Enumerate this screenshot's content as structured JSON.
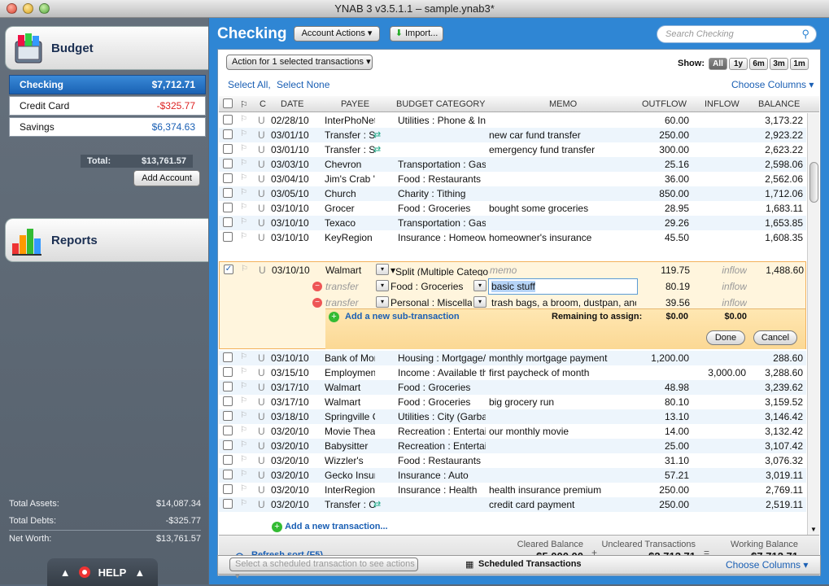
{
  "window": {
    "title": "YNAB 3 v3.5.1.1 – sample.ynab3*"
  },
  "sidebar": {
    "budget_label": "Budget",
    "reports_label": "Reports",
    "accounts": [
      {
        "name": "Checking",
        "amount": "$7,712.71"
      },
      {
        "name": "Credit Card",
        "amount": "-$325.77"
      },
      {
        "name": "Savings",
        "amount": "$6,374.63"
      }
    ],
    "total_label": "Total:",
    "total_value": "$13,761.57",
    "add_account": "Add Account",
    "total_assets_label": "Total Assets:",
    "total_assets": "$14,087.34",
    "total_debts_label": "Total Debts:",
    "total_debts": "-$325.77",
    "net_worth_label": "Net Worth:",
    "net_worth": "$13,761.57",
    "help": "HELP"
  },
  "header": {
    "title": "Checking",
    "account_actions": "Account Actions",
    "import": "Import...",
    "search_placeholder": "Search Checking"
  },
  "toolbar": {
    "action": "Action for 1 selected transactions",
    "show": "Show:",
    "show_options": [
      "All",
      "1y",
      "6m",
      "3m",
      "1m"
    ],
    "select_all": "Select All,",
    "select_none": "Select None",
    "choose_columns": "Choose Columns"
  },
  "columns": {
    "c": "C",
    "date": "DATE",
    "payee": "PAYEE",
    "category": "BUDGET CATEGORY",
    "memo": "MEMO",
    "outflow": "OUTFLOW",
    "inflow": "INFLOW",
    "balance": "BALANCE"
  },
  "rows_top": [
    {
      "c": "U",
      "date": "02/28/10",
      "payee": "InterPhoNet",
      "category": "Utilities : Phone & Inte",
      "memo": "",
      "outflow": "60.00",
      "inflow": "",
      "balance": "3,173.22"
    },
    {
      "c": "U",
      "date": "03/01/10",
      "payee": "Transfer : Sa",
      "category": "",
      "memo": "new car fund transfer",
      "outflow": "250.00",
      "inflow": "",
      "balance": "2,923.22"
    },
    {
      "c": "U",
      "date": "03/01/10",
      "payee": "Transfer : Sa",
      "category": "",
      "memo": "emergency fund transfer",
      "outflow": "300.00",
      "inflow": "",
      "balance": "2,623.22"
    },
    {
      "c": "U",
      "date": "03/03/10",
      "payee": "Chevron",
      "category": "Transportation : Gas",
      "memo": "",
      "outflow": "25.16",
      "inflow": "",
      "balance": "2,598.06"
    },
    {
      "c": "U",
      "date": "03/04/10",
      "payee": "Jim's Crab 'n Gr",
      "category": "Food : Restaurants",
      "memo": "",
      "outflow": "36.00",
      "inflow": "",
      "balance": "2,562.06"
    },
    {
      "c": "U",
      "date": "03/05/10",
      "payee": "Church",
      "category": "Charity : Tithing",
      "memo": "",
      "outflow": "850.00",
      "inflow": "",
      "balance": "1,712.06"
    },
    {
      "c": "U",
      "date": "03/10/10",
      "payee": "Grocer",
      "category": "Food : Groceries",
      "memo": "bought some groceries",
      "outflow": "28.95",
      "inflow": "",
      "balance": "1,683.11"
    },
    {
      "c": "U",
      "date": "03/10/10",
      "payee": "Texaco",
      "category": "Transportation : Gas",
      "memo": "",
      "outflow": "29.26",
      "inflow": "",
      "balance": "1,653.85"
    },
    {
      "c": "U",
      "date": "03/10/10",
      "payee": "KeyRegion Insu",
      "category": "Insurance : Homeow",
      "memo": "homeowner's insurance",
      "outflow": "45.50",
      "inflow": "",
      "balance": "1,608.35"
    }
  ],
  "split": {
    "c": "U",
    "date": "03/10/10",
    "payee": "Walmart",
    "category": "Split (Multiple Catego",
    "memo": "memo",
    "outflow": "119.75",
    "inflow": "inflow",
    "balance": "1,488.60",
    "subs": [
      {
        "payee": "transfer",
        "category": "Food : Groceries",
        "memo": "basic stuff",
        "outflow": "80.19",
        "inflow": "inflow"
      },
      {
        "payee": "transfer",
        "category": "Personal : Miscellan",
        "memo": "trash bags, a broom, dustpan, and",
        "outflow": "39.56",
        "inflow": "inflow"
      }
    ],
    "add_sub": "Add a new sub-transaction",
    "remaining_label": "Remaining to assign:",
    "remaining_out": "$0.00",
    "remaining_in": "$0.00",
    "done": "Done",
    "cancel": "Cancel"
  },
  "rows_bottom": [
    {
      "c": "U",
      "date": "03/10/10",
      "payee": "Bank of Mortga",
      "category": "Housing : Mortgage/",
      "memo": "monthly mortgage payment",
      "outflow": "1,200.00",
      "inflow": "",
      "balance": "288.60"
    },
    {
      "c": "U",
      "date": "03/15/10",
      "payee": "Employment",
      "category": "Income : Available thi",
      "memo": "first paycheck of month",
      "outflow": "",
      "inflow": "3,000.00",
      "balance": "3,288.60"
    },
    {
      "c": "U",
      "date": "03/17/10",
      "payee": "Walmart",
      "category": "Food : Groceries",
      "memo": "",
      "outflow": "48.98",
      "inflow": "",
      "balance": "3,239.62"
    },
    {
      "c": "U",
      "date": "03/17/10",
      "payee": "Walmart",
      "category": "Food : Groceries",
      "memo": "big grocery run",
      "outflow": "80.10",
      "inflow": "",
      "balance": "3,159.52"
    },
    {
      "c": "U",
      "date": "03/18/10",
      "payee": "Springville City",
      "category": "Utilities : City (Garbag",
      "memo": "",
      "outflow": "13.10",
      "inflow": "",
      "balance": "3,146.42"
    },
    {
      "c": "U",
      "date": "03/20/10",
      "payee": "Movie Theater",
      "category": "Recreation : Entertair",
      "memo": "our monthly movie",
      "outflow": "14.00",
      "inflow": "",
      "balance": "3,132.42"
    },
    {
      "c": "U",
      "date": "03/20/10",
      "payee": "Babysitter",
      "category": "Recreation : Entertain",
      "memo": "",
      "outflow": "25.00",
      "inflow": "",
      "balance": "3,107.42"
    },
    {
      "c": "U",
      "date": "03/20/10",
      "payee": "Wizzler's",
      "category": "Food : Restaurants",
      "memo": "",
      "outflow": "31.10",
      "inflow": "",
      "balance": "3,076.32"
    },
    {
      "c": "U",
      "date": "03/20/10",
      "payee": "Gecko Insuranc",
      "category": "Insurance : Auto",
      "memo": "",
      "outflow": "57.21",
      "inflow": "",
      "balance": "3,019.11"
    },
    {
      "c": "U",
      "date": "03/20/10",
      "payee": "InterRegion Hea",
      "category": "Insurance : Health",
      "memo": "health insurance premium",
      "outflow": "250.00",
      "inflow": "",
      "balance": "2,769.11"
    },
    {
      "c": "U",
      "date": "03/20/10",
      "payee": "Transfer : Cre",
      "category": "",
      "memo": "credit card payment",
      "outflow": "250.00",
      "inflow": "",
      "balance": "2,519.11"
    }
  ],
  "add_transaction": "Add a new transaction...",
  "footer": {
    "refresh": "Refresh sort (F5)",
    "cleared_label": "Cleared Balance",
    "cleared": "$5,000.00",
    "uncleared_label": "Uncleared Transactions",
    "uncleared": "$2,712.71",
    "working_label": "Working Balance",
    "working": "$7,712.71",
    "plus": "+",
    "equals": "="
  },
  "scheduled": {
    "select_placeholder": "Select a scheduled transaction to see actions",
    "title": "Scheduled Transactions",
    "choose_columns": "Choose Columns"
  }
}
